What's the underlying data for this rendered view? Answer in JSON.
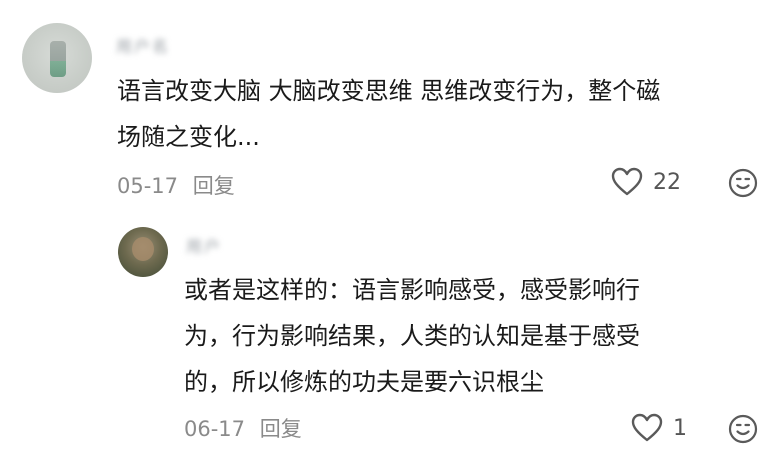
{
  "comments": [
    {
      "name": "用户名",
      "lines": [
        "语言改变大脑 大脑改变思维 思维改变行为，整个磁",
        "场随之变化..."
      ],
      "date": "05-17",
      "reply_label": "回复",
      "likes": "22"
    }
  ],
  "reply": {
    "name": "用户",
    "lines": [
      "或者是这样的：语言影响感受，感受影响行",
      "为，行为影响结果，人类的认知是基于感受",
      "的，所以修炼的功夫是要六识根尘"
    ],
    "date": "06-17",
    "reply_label": "回复",
    "likes": "1"
  },
  "icons": {
    "like": "heart-outline-icon",
    "emoji": "emoji-smile-icon"
  }
}
